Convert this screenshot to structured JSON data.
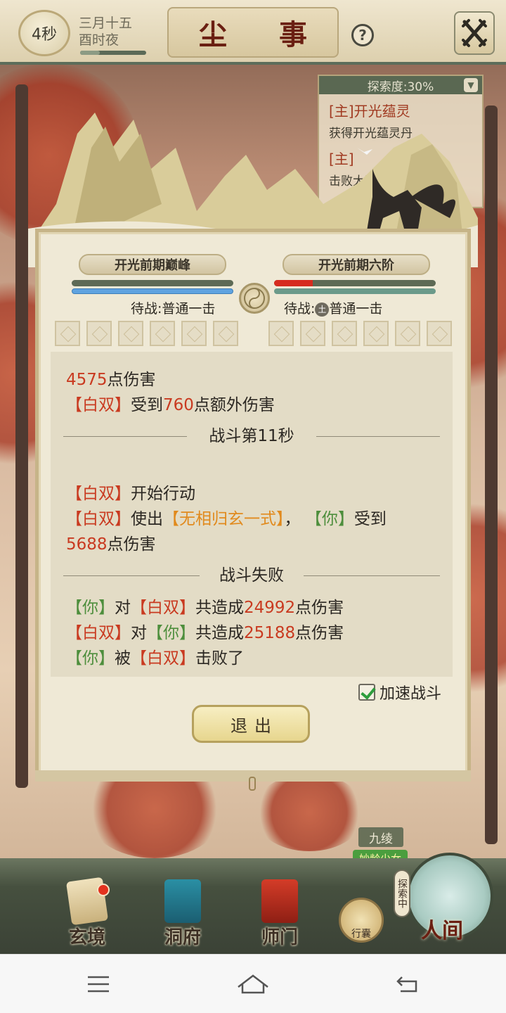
{
  "header": {
    "timer": "4秒",
    "date_line1": "三月十五",
    "date_line2": "酉时夜",
    "title": "尘 事",
    "help_label": "?",
    "close_icon": "crossed-swords-icon"
  },
  "quest_panel": {
    "progress": "探索度:30%",
    "item1_title": "[主]开光蕴灵",
    "item1_desc": "获得开光蕴灵丹",
    "item2_title": "[主]",
    "item2_desc": "击败大陆"
  },
  "battle": {
    "left_rank": "开光前期巅峰",
    "right_rank": "开光前期六阶",
    "left_status": "待战:普通一击",
    "right_status_prefix": "待战:",
    "right_status_badge": "土",
    "right_status_action": "普通一击",
    "left_hp_fraction": 1.0,
    "left_mp_fraction": 1.0,
    "right_hp_fraction": 0.24,
    "right_mp_fraction": 1.0
  },
  "log": {
    "l1_num": "4575",
    "l1_text": "点伤害",
    "l2_name": "【白双】",
    "l2_text1": "受到",
    "l2_num": "760",
    "l2_text2": "点额外伤害",
    "sep1": "战斗第11秒",
    "l3_name": "【白双】",
    "l3_text": "开始行动",
    "l4_name": "【白双】",
    "l4_text1": "使出",
    "l4_skill": "【无相归玄一式】",
    "l4_comma": "，",
    "l4_you": "【你】",
    "l4_text2": "受到",
    "l5_num": "5688",
    "l5_text": "点伤害",
    "sep2": "战斗失败",
    "l6_you": "【你】",
    "l6_dui": "对",
    "l6_name": "【白双】",
    "l6_text1": "共造成",
    "l6_num": "24992",
    "l6_text2": "点伤害",
    "l7_name": "【白双】",
    "l7_dui": "对",
    "l7_you": "【你】",
    "l7_text1": "共造成",
    "l7_num": "25188",
    "l7_text2": "点伤害",
    "l8_you": "【你】",
    "l8_bei": "被",
    "l8_name": "【白双】",
    "l8_text": "击败了"
  },
  "controls": {
    "speedup_label": "加速战斗",
    "speedup_checked": true,
    "exit_label": "退出"
  },
  "scene": {
    "npc_name": "九绫",
    "npc_tag": "妙龄少女"
  },
  "bottom_nav": {
    "items": [
      "玄境",
      "洞府",
      "师门"
    ],
    "bag_label": "行囊",
    "explore_tag": "探索中",
    "renjian_label": "人间"
  },
  "colors": {
    "damage_red": "#c93a20",
    "ally_green": "#4d8e3c",
    "skill_orange": "#e18a1d",
    "title_red": "#6a1f12"
  }
}
